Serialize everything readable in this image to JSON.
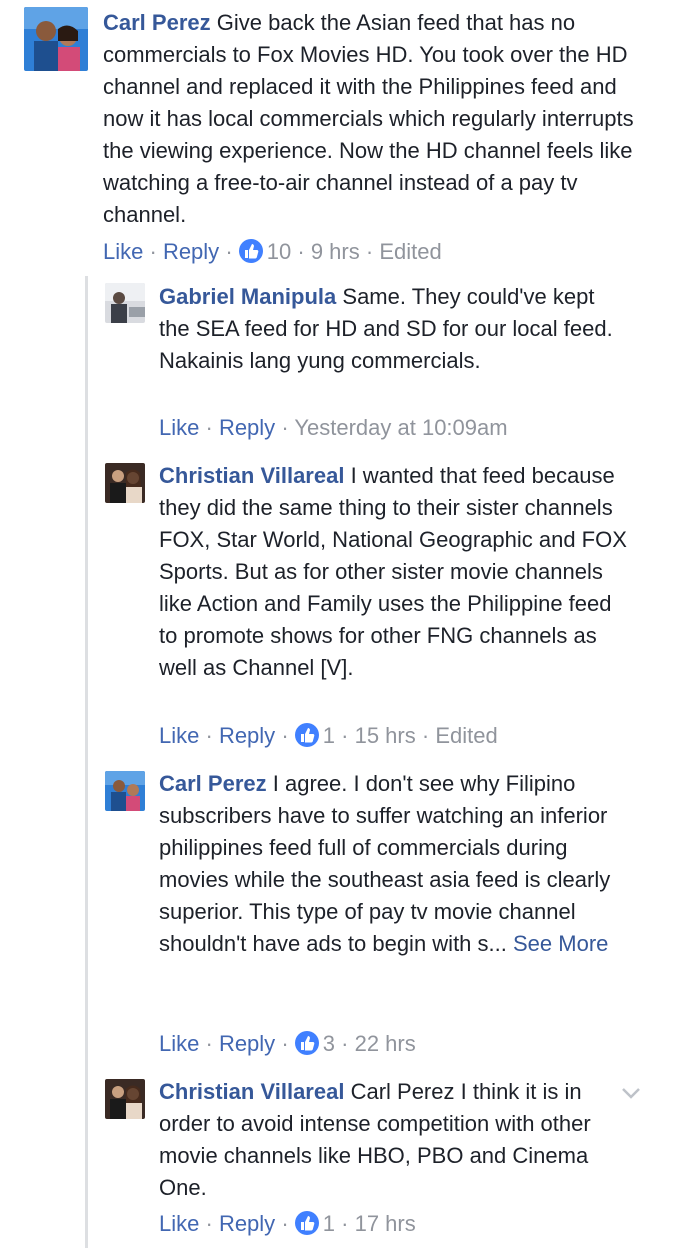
{
  "comments": [
    {
      "author": "Carl Perez",
      "text": "Give back the Asian feed that has no commercials to Fox Movies HD. You took over the HD channel and replaced it with the Philippines feed and now it has local commercials which regularly interrupts the viewing experience. Now the HD channel feels like watching a free-to-air channel instead of a pay tv channel.",
      "like_label": "Like",
      "reply_label": "Reply",
      "reactions": "10",
      "time": "9 hrs",
      "edited": "Edited"
    },
    {
      "author": "Gabriel Manipula",
      "text": "Same. They could've kept the SEA feed for HD and SD for our local feed. Nakainis lang yung commercials.",
      "like_label": "Like",
      "reply_label": "Reply",
      "time": "Yesterday at 10:09am"
    },
    {
      "author": "Christian Villareal",
      "text": "I wanted that feed because they did the same thing to their sister channels FOX, Star World, National Geographic and FOX Sports. But as for other sister movie channels like Action and Family uses the Philippine feed to promote shows for other FNG channels as well as Channel [V].",
      "like_label": "Like",
      "reply_label": "Reply",
      "reactions": "1",
      "time": "15 hrs",
      "edited": "Edited"
    },
    {
      "author": "Carl Perez",
      "text": "I agree. I don't see why Filipino subscribers have to suffer watching an inferior philippines feed full of commercials during movies while the southeast asia feed is clearly superior. This type of pay tv movie channel shouldn't have ads to begin with s...",
      "see_more": "See More",
      "like_label": "Like",
      "reply_label": "Reply",
      "reactions": "3",
      "time": "22 hrs"
    },
    {
      "author": "Christian Villareal",
      "text": "Carl Perez I think it is in order to avoid intense competition with other movie channels like HBO, PBO and Cinema One.",
      "like_label": "Like",
      "reply_label": "Reply",
      "reactions": "1",
      "time": "17 hrs"
    }
  ],
  "separator": "·",
  "icons": {
    "reaction": "like-thumb-icon",
    "menu": "chevron-down-icon"
  },
  "colors": {
    "name": "#365899",
    "link": "#4267b2",
    "meta": "#90949c",
    "like": "#4080ff",
    "thread_line": "#dddfe2"
  }
}
